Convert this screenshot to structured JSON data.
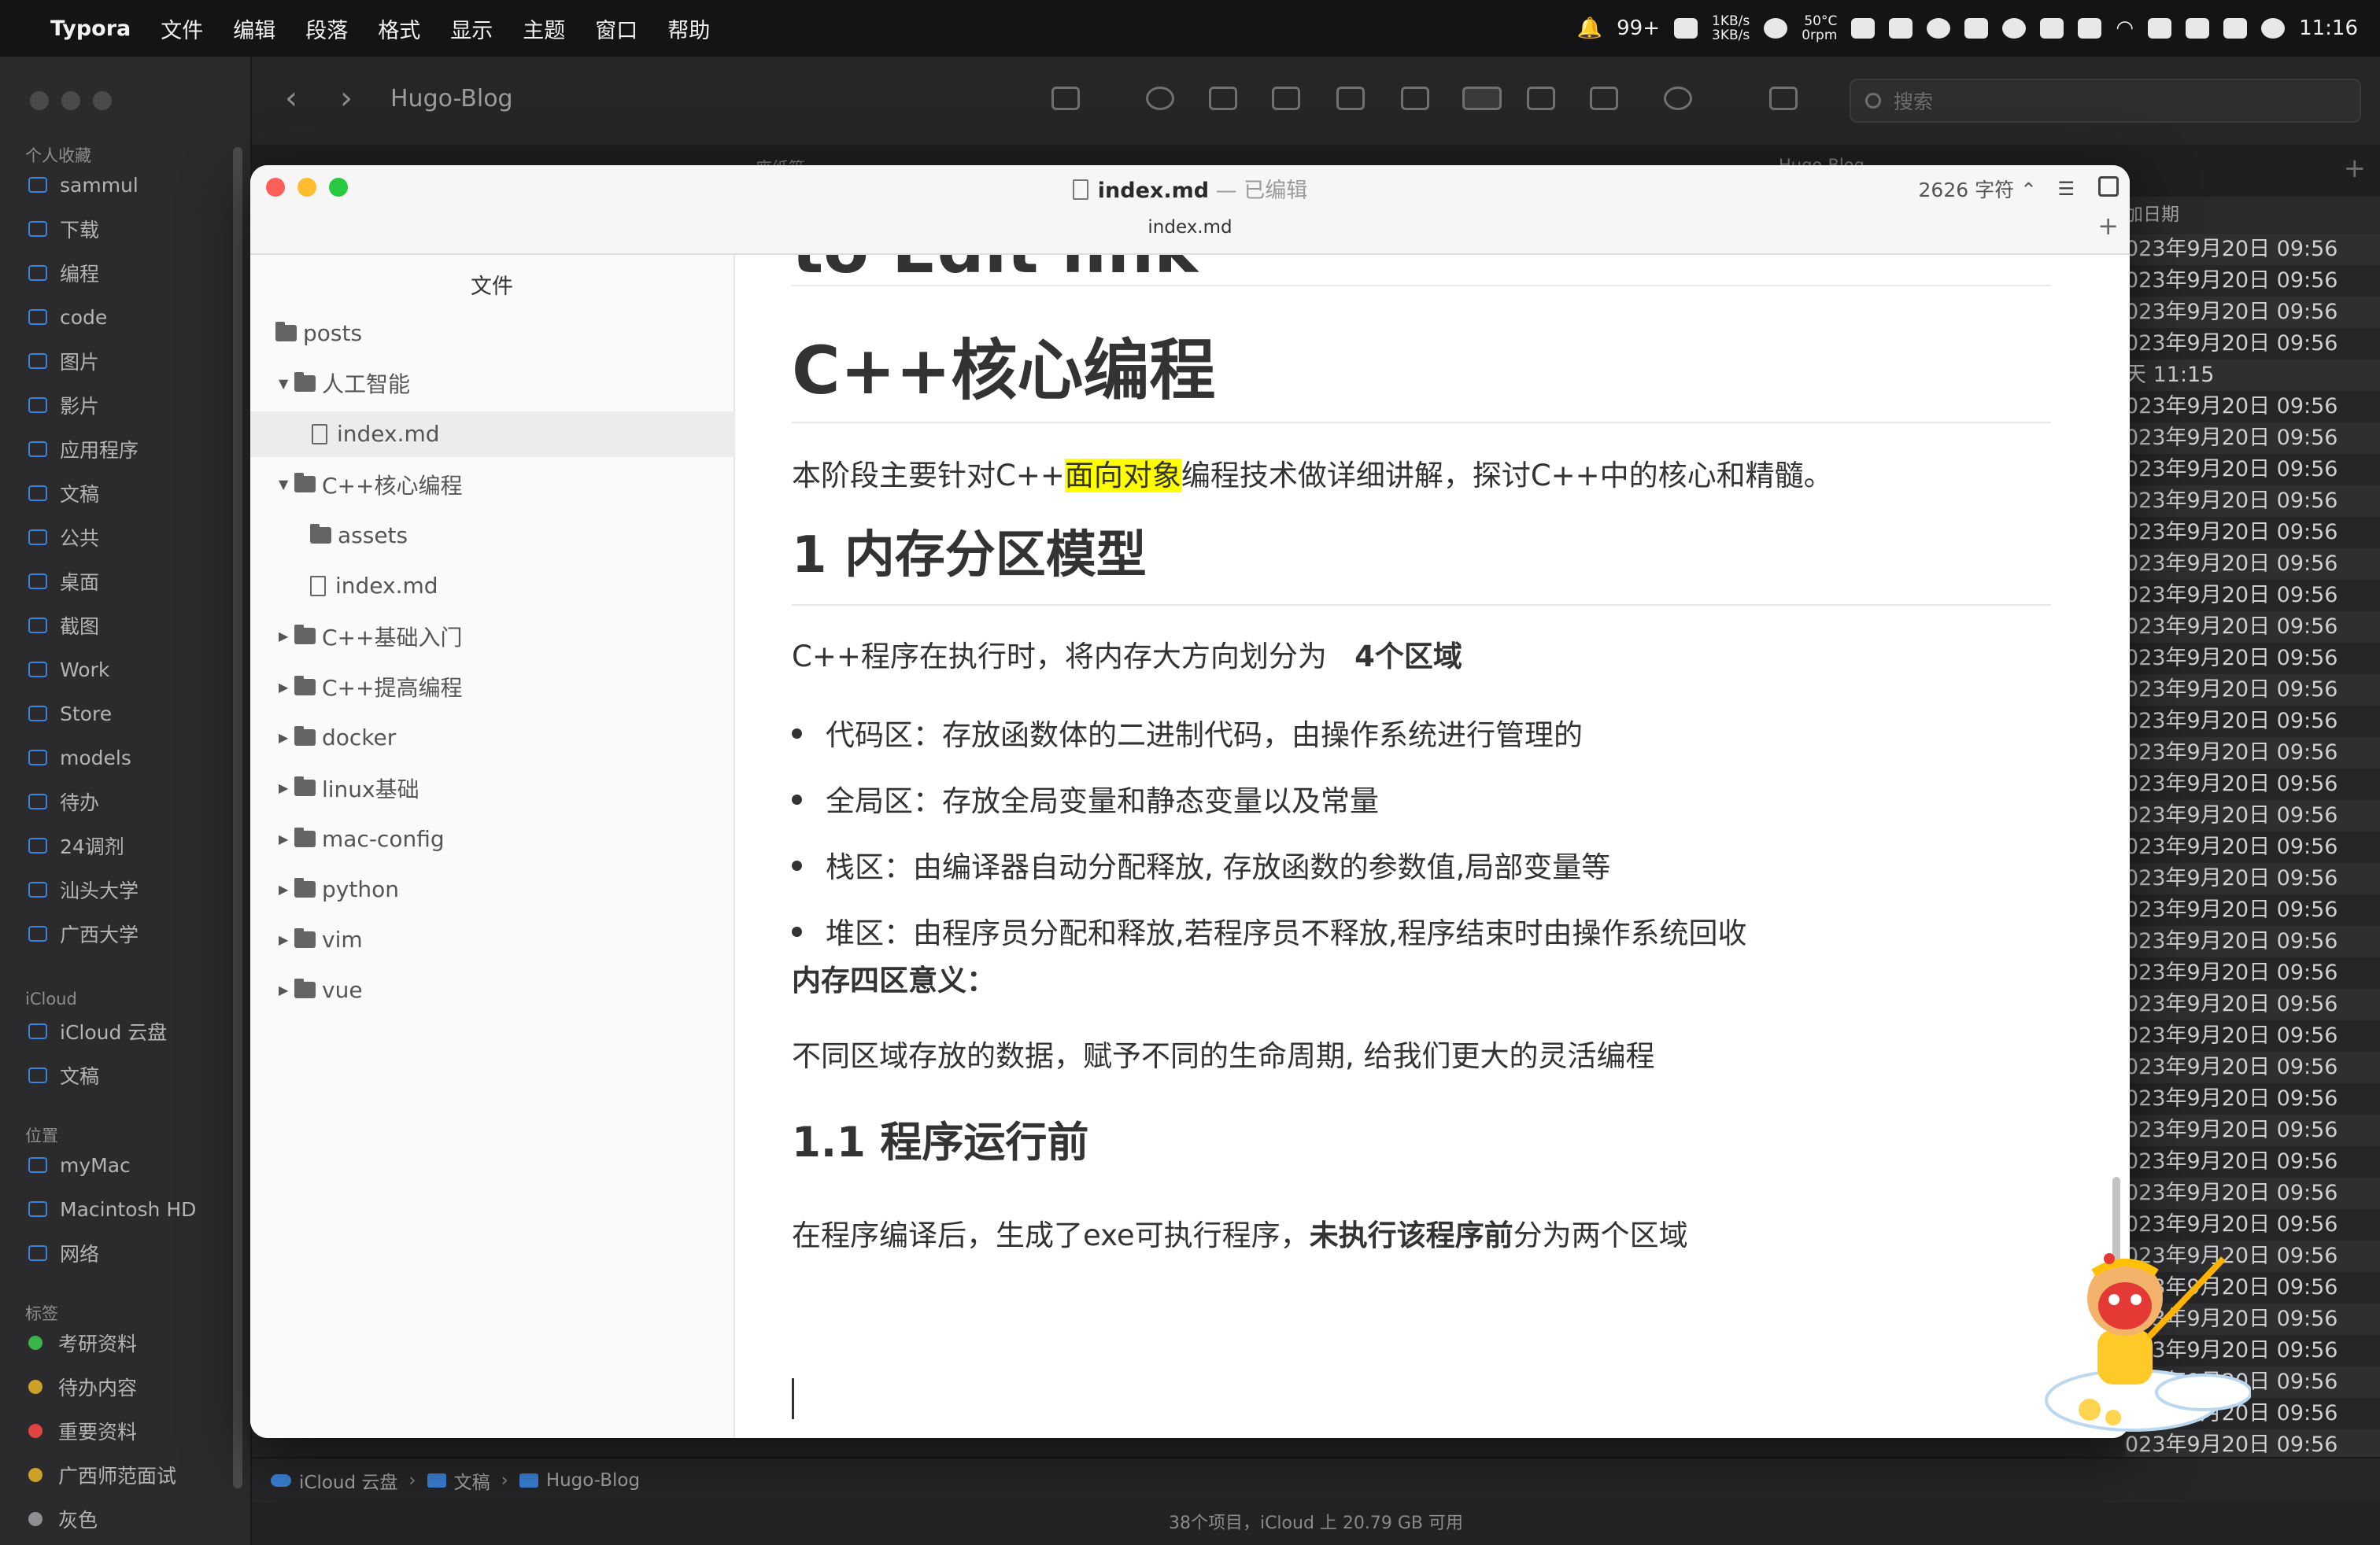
{
  "menubar": {
    "app": "Typora",
    "items": [
      "文件",
      "编辑",
      "段落",
      "格式",
      "显示",
      "主题",
      "窗口",
      "帮助"
    ],
    "notifications": "99+",
    "net_up": "1KB/s",
    "net_down": "3KB/s",
    "temp": "50°C",
    "fan": "0rpm",
    "clock": "11:16"
  },
  "finder": {
    "title": "Hugo-Blog",
    "search_placeholder": "搜索",
    "tabs": [
      "废纸篓",
      "Hugo-Blog"
    ],
    "sidebar": {
      "favorites_heading": "个人收藏",
      "favorites": [
        "sammul",
        "下载",
        "编程",
        "code",
        "图片",
        "影片",
        "应用程序",
        "文稿",
        "公共",
        "桌面",
        "截图",
        "Work",
        "Store",
        "models",
        "待办",
        "24调剂",
        "汕头大学",
        "广西大学"
      ],
      "icloud_heading": "iCloud",
      "icloud": [
        "iCloud 云盘",
        "文稿"
      ],
      "locations_heading": "位置",
      "locations": [
        "myMac",
        "Macintosh HD",
        "网络"
      ],
      "tags_heading": "标签",
      "tags": [
        {
          "label": "考研资料",
          "color": "#3bb54a"
        },
        {
          "label": "待办内容",
          "color": "#c9a227"
        },
        {
          "label": "重要资料",
          "color": "#e0443e"
        },
        {
          "label": "广西师范面试",
          "color": "#c9a227"
        },
        {
          "label": "灰色",
          "color": "#8e8e93"
        }
      ]
    },
    "column_header": "加日期",
    "dates": [
      "023年9月20日 09:56",
      "023年9月20日 09:56",
      "023年9月20日 09:56",
      "023年9月20日 09:56",
      "天 11:15",
      "023年9月20日 09:56",
      "023年9月20日 09:56",
      "023年9月20日 09:56",
      "023年9月20日 09:56",
      "023年9月20日 09:56",
      "023年9月20日 09:56",
      "023年9月20日 09:56",
      "023年9月20日 09:56",
      "023年9月20日 09:56",
      "023年9月20日 09:56",
      "023年9月20日 09:56",
      "023年9月20日 09:56",
      "023年9月20日 09:56",
      "023年9月20日 09:56",
      "023年9月20日 09:56",
      "023年9月20日 09:56",
      "023年9月20日 09:56",
      "023年9月20日 09:56",
      "023年9月20日 09:56",
      "023年9月20日 09:56",
      "023年9月20日 09:56",
      "023年9月20日 09:56",
      "023年9月20日 09:56",
      "023年9月20日 09:56",
      "023年9月20日 09:56",
      "023年9月20日 09:56",
      "023年9月20日 09:56",
      "023年9月20日 09:56",
      "023年9月20日 09:56",
      "023年9月20日 09:56",
      "023年9月20日 09:56",
      "023年9月20日 09:56",
      "023年9月20日 09:56",
      "023年9月20日 09:56"
    ],
    "path": [
      "iCloud 云盘",
      "文稿",
      "Hugo-Blog"
    ],
    "status": "38个项目，iCloud 上 20.79 GB 可用"
  },
  "typora": {
    "filename": "index.md",
    "edited": "— 已编辑",
    "char_count": "2626 字符 ⌃",
    "tab": "index.md",
    "tree_title": "文件",
    "tree": [
      {
        "label": "posts",
        "kind": "folder",
        "level": 0,
        "arrow": ""
      },
      {
        "label": "人工智能",
        "kind": "folder",
        "level": 1,
        "arrow": "▼"
      },
      {
        "label": "index.md",
        "kind": "file",
        "level": 2,
        "arrow": "",
        "selected": true
      },
      {
        "label": "C++核心编程",
        "kind": "folder",
        "level": 1,
        "arrow": "▼"
      },
      {
        "label": "assets",
        "kind": "folder",
        "level": 2,
        "arrow": ""
      },
      {
        "label": "index.md",
        "kind": "file",
        "level": 2,
        "arrow": ""
      },
      {
        "label": "C++基础入门",
        "kind": "folder",
        "level": 1,
        "arrow": "▶"
      },
      {
        "label": "C++提高编程",
        "kind": "folder",
        "level": 1,
        "arrow": "▶"
      },
      {
        "label": "docker",
        "kind": "folder",
        "level": 1,
        "arrow": "▶"
      },
      {
        "label": "linux基础",
        "kind": "folder",
        "level": 1,
        "arrow": "▶"
      },
      {
        "label": "mac-config",
        "kind": "folder",
        "level": 1,
        "arrow": "▶"
      },
      {
        "label": "python",
        "kind": "folder",
        "level": 1,
        "arrow": "▶"
      },
      {
        "label": "vim",
        "kind": "folder",
        "level": 1,
        "arrow": "▶"
      },
      {
        "label": "vue",
        "kind": "folder",
        "level": 1,
        "arrow": "▶"
      }
    ],
    "doc": {
      "cut_heading": "to Edit link",
      "h1": "C++核心编程",
      "intro_a": "本阶段主要针对C++",
      "intro_mark": "面向对象",
      "intro_b": "编程技术做详细讲解，探讨C++中的核心和精髓。",
      "h2": "1 内存分区模型",
      "p1_a": "C++程序在执行时，将内存大方向划分为",
      "p1_b": "4个区域",
      "bullets": [
        "代码区：存放函数体的二进制代码，由操作系统进行管理的",
        "全局区：存放全局变量和静态变量以及常量",
        "栈区：由编译器自动分配释放, 存放函数的参数值,局部变量等",
        "堆区：由程序员分配和释放,若程序员不释放,程序结束时由操作系统回收"
      ],
      "meaning": "内存四区意义：",
      "p2": "不同区域存放的数据，赋予不同的生命周期, 给我们更大的灵活编程",
      "h3": "1.1 程序运行前",
      "p3_a": "在程序编译后，生成了exe可执行程序，",
      "p3_b": "未执行该程序前",
      "p3_c": "分为两个区域"
    }
  }
}
